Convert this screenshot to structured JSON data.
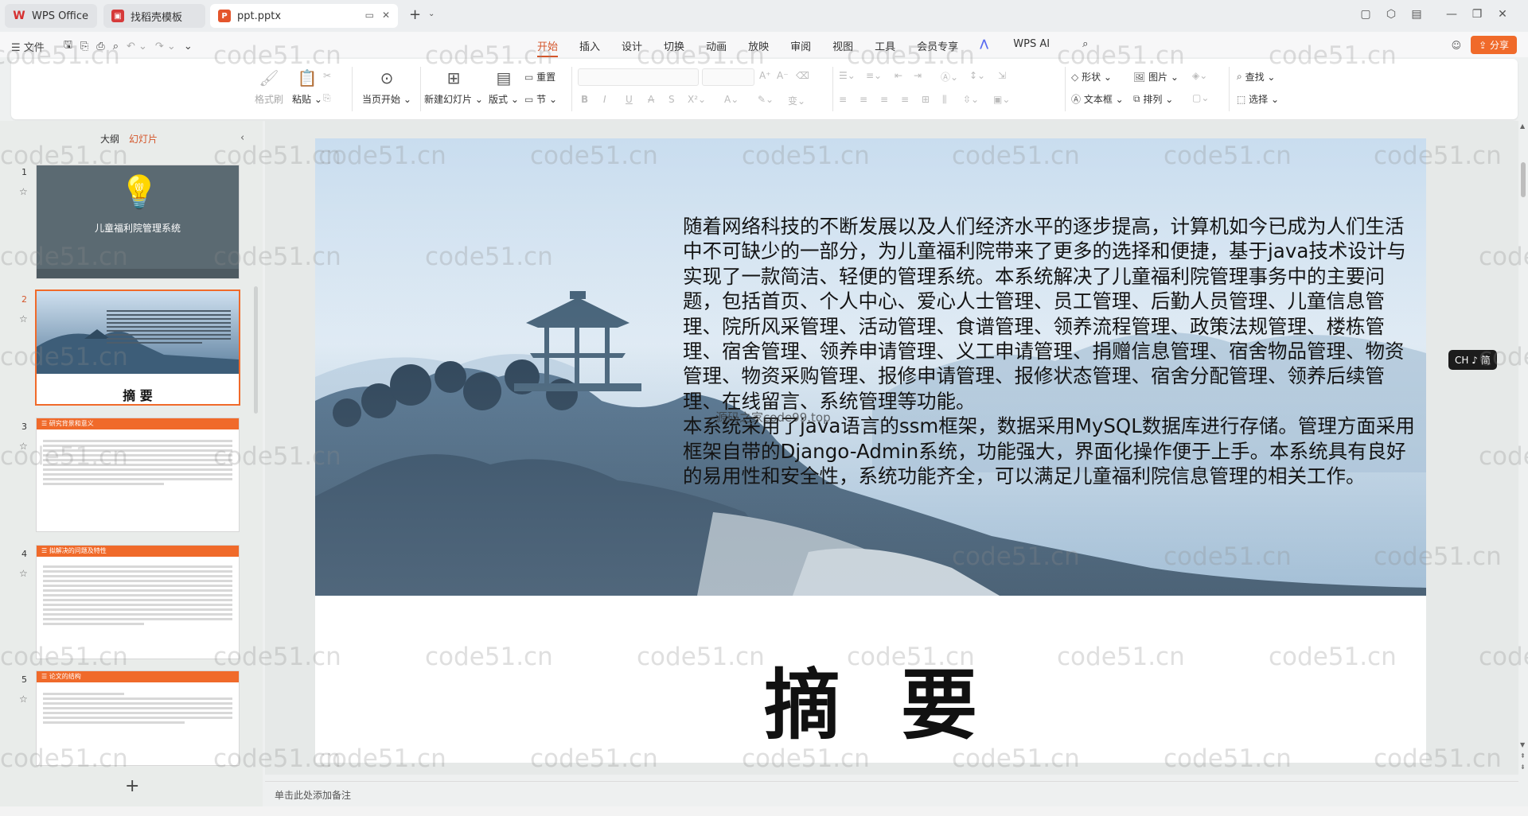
{
  "tabs": [
    {
      "label": "WPS Office",
      "icon": "wps-logo-icon"
    },
    {
      "label": "找稻壳模板",
      "icon": "template-icon"
    },
    {
      "label": "ppt.pptx",
      "icon": "ppt-icon"
    }
  ],
  "menu": {
    "file_label": "文件",
    "tabs": [
      "开始",
      "插入",
      "设计",
      "切换",
      "动画",
      "放映",
      "审阅",
      "视图",
      "工具",
      "会员专享"
    ],
    "active_tab": "开始",
    "wps_ai": "WPS AI",
    "share": "分享"
  },
  "ribbon": {
    "format_painter": "格式刷",
    "paste": "粘贴",
    "play_from_current": "当页开始",
    "new_slide": "新建幻灯片",
    "layout": "版式",
    "section": "节",
    "reset": "重置",
    "shape": "形状",
    "picture": "图片",
    "textbox": "文本框",
    "arrange": "排列",
    "find": "查找",
    "select": "选择"
  },
  "left_panel": {
    "tab_outline": "大纲",
    "tab_slides": "幻灯片",
    "slides": [
      {
        "number": "1",
        "title": "儿童福利院管理系统"
      },
      {
        "number": "2",
        "title": "摘    要"
      },
      {
        "number": "3",
        "title": "研究背景和意义"
      },
      {
        "number": "4",
        "title": "拟解决的问题及特性"
      },
      {
        "number": "5",
        "title": "论文的结构"
      }
    ]
  },
  "slide": {
    "paragraph1": "随着网络科技的不断发展以及人们经济水平的逐步提高，计算机如今已成为人们生活中不可缺少的一部分，为儿童福利院带来了更多的选择和便捷，基于java技术设计与实现了一款简洁、轻便的管理系统。本系统解决了儿童福利院管理事务中的主要问题，包括首页、个人中心、爱心人士管理、员工管理、后勤人员管理、儿童信息管理、院所风采管理、活动管理、食谱管理、领养流程管理、政策法规管理、楼栋管理、宿舍管理、领养申请管理、义工申请管理、捐赠信息管理、宿舍物品管理、物资管理、物资采购管理、报修申请管理、报修状态管理、宿舍分配管理、领养后续管理、在线留言、系统管理等功能。",
    "paragraph2": "本系统采用了java语言的ssm框架，数据采用MySQL数据库进行存储。管理方面采用框架自带的Django-Admin系统，功能强大，界面化操作便于上手。本系统具有良好的易用性和安全性，系统功能齐全，可以满足儿童福利院信息管理的相关工作。",
    "title_part1": "摘",
    "title_part2": "要",
    "inline_watermark": "—源码之家code99.top"
  },
  "ime_badge": "CH ♪ 简",
  "notes_placeholder": "单击此处添加备注",
  "watermark_text": "code51.cn",
  "colors": {
    "accent": "#d4562b",
    "share": "#f06a2a"
  }
}
